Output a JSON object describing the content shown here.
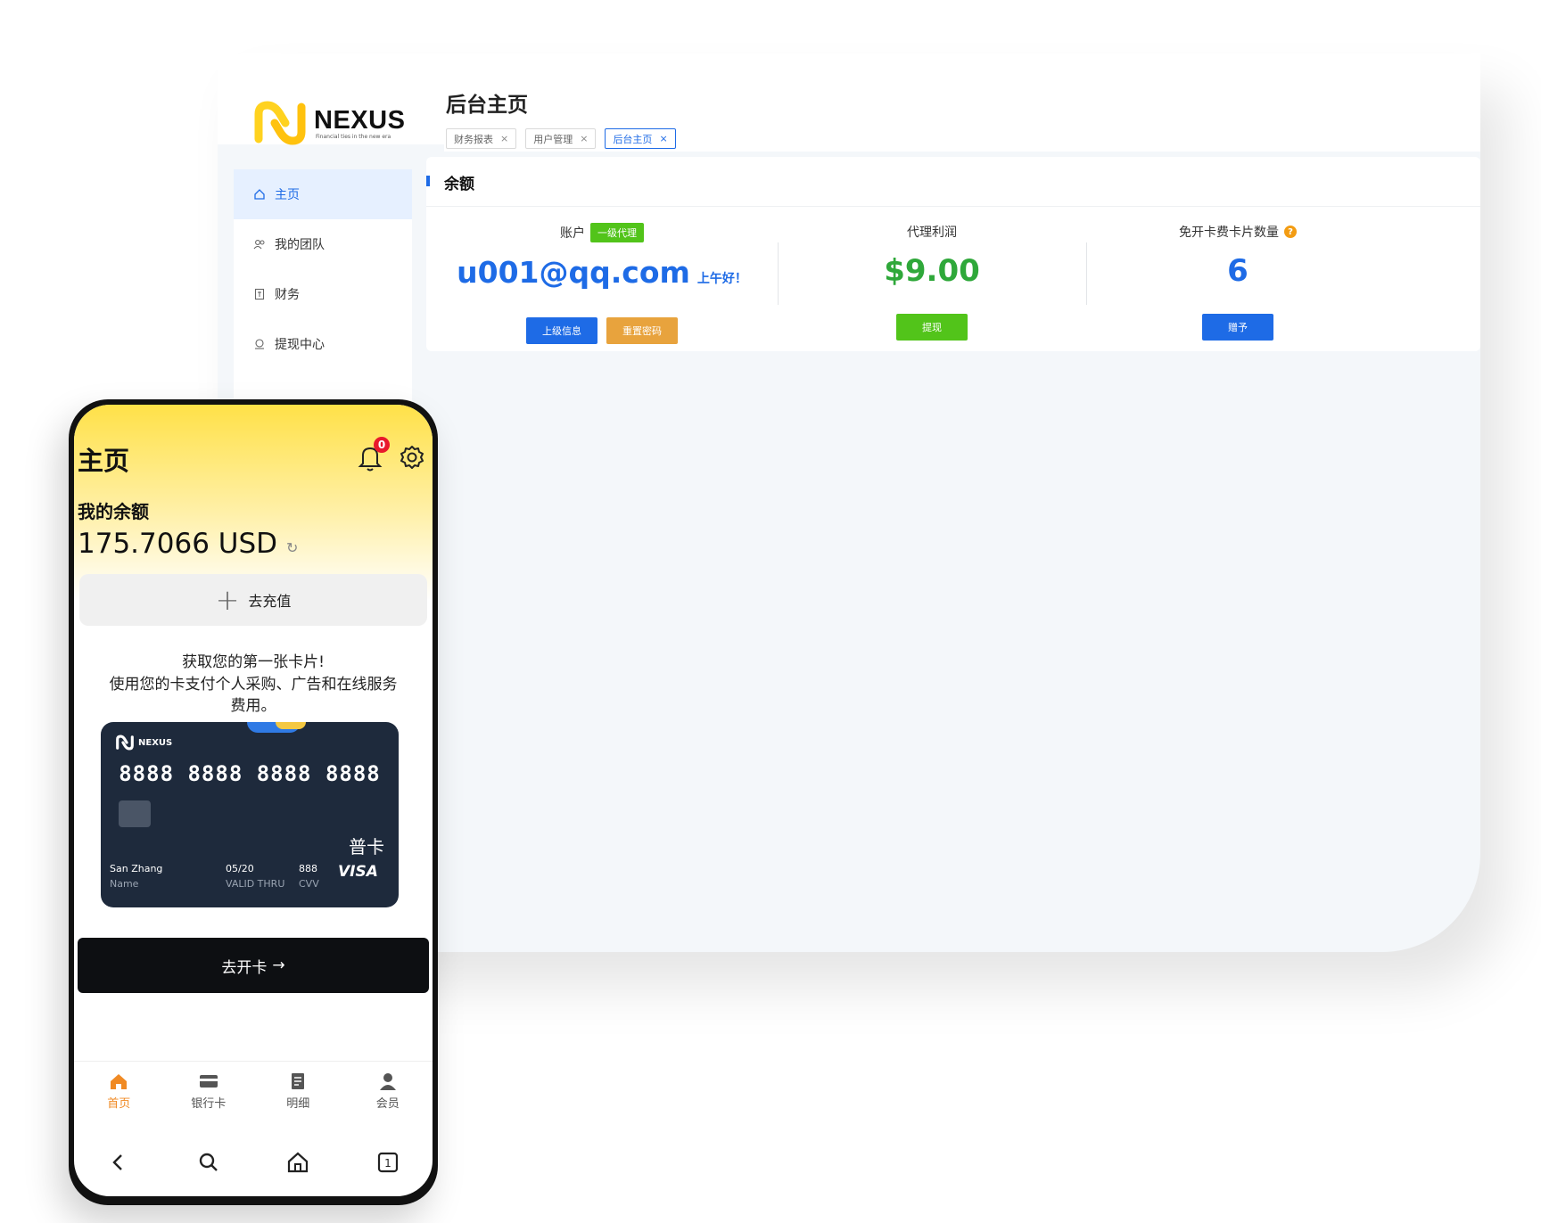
{
  "desktop": {
    "logo": {
      "word": "NEXUS",
      "tagline": "Financial ties in the new era"
    },
    "sidebar": {
      "items": [
        {
          "label": "主页",
          "icon": "home-icon"
        },
        {
          "label": "我的团队",
          "icon": "team-icon"
        },
        {
          "label": "财务",
          "icon": "finance-icon"
        },
        {
          "label": "提现中心",
          "icon": "withdraw-icon"
        }
      ]
    },
    "header": {
      "title": "后台主页",
      "tabs": [
        {
          "label": "财务报表"
        },
        {
          "label": "用户管理"
        },
        {
          "label": "后台主页"
        }
      ],
      "tab_close": "×"
    },
    "balance_card": {
      "title": "余额",
      "account": {
        "label": "账户",
        "badge": "一级代理",
        "email": "u001@qq.com",
        "greeting": "上午好！",
        "buttons": [
          "上级信息",
          "重置密码"
        ]
      },
      "profit": {
        "label": "代理利润",
        "value": "$9.00",
        "button": "提现"
      },
      "free_cards": {
        "label": "免开卡费卡片数量",
        "help": "?",
        "value": "6",
        "button": "赠予"
      }
    },
    "colors": {
      "primary": "#1e6be6",
      "success": "#52c41a",
      "warning": "#e8a33d",
      "profit": "#2fa83a"
    }
  },
  "phone": {
    "title": "主页",
    "notification_count": "0",
    "balance_label": "我的余额",
    "balance_value": "175.7066 USD",
    "recharge_label": "去充值",
    "promo_title": "获取您的第一张卡片!",
    "promo_text": "使用您的卡支付个人采购、广告和在线服务费用。",
    "card": {
      "brand": "NEXUS",
      "number": "8888 8888 8888 8888",
      "type": "普卡",
      "holder": "San Zhang",
      "holder_label": "Name",
      "expiry": "05/20",
      "expiry_label": "VALID THRU",
      "cvv": "888",
      "cvv_label": "CVV",
      "network": "VISA"
    },
    "open_card_label": "去开卡",
    "open_card_arrow": "→",
    "tabbar": [
      {
        "label": "首页",
        "icon": "home-icon",
        "active": true
      },
      {
        "label": "银行卡",
        "icon": "bank-card-icon",
        "active": false
      },
      {
        "label": "明细",
        "icon": "details-icon",
        "active": false
      },
      {
        "label": "会员",
        "icon": "member-icon",
        "active": false
      }
    ],
    "accent": "#f08a24"
  }
}
